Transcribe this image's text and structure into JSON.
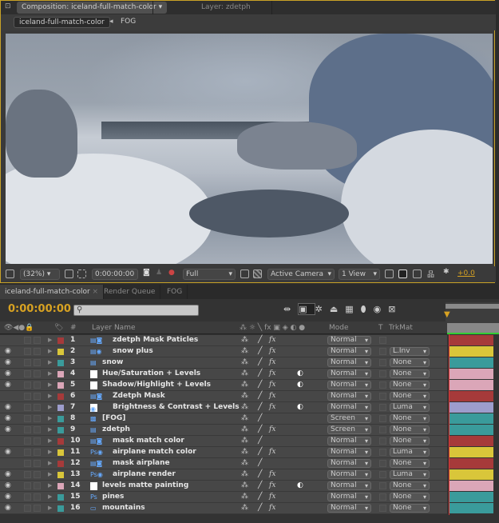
{
  "comp_panel": {
    "tab_label": "Composition: iceland-full-match-color",
    "layer_tab": "Layer: zdetph",
    "breadcrumb_active": "iceland-full-match-color",
    "breadcrumb_next": "FOG"
  },
  "viewer_toolbar": {
    "zoom": "(32%)",
    "timecode": "0:00:00:00",
    "resolution": "Full",
    "camera": "Active Camera",
    "views": "1 View",
    "exposure": "+0.0"
  },
  "timeline": {
    "tabs": [
      "iceland-full-match-color",
      "Render Queue",
      "FOG"
    ],
    "timecode": "0:00:00:00",
    "search_placeholder": "",
    "headers": {
      "num": "#",
      "layer_name": "Layer Name",
      "mode": "Mode",
      "t": "T",
      "trkmat": "TrkMat"
    }
  },
  "colors": {
    "red": "#a63a3a",
    "yellow": "#d9c63a",
    "teal": "#3a9b9b",
    "pink": "#dba6b8",
    "lavender": "#9d9dcc",
    "accent": "#d8a222"
  },
  "layers": [
    {
      "num": "1",
      "name": "zdetph Mask Paticles",
      "label": "red",
      "visible": false,
      "icon": "comp-mask",
      "fx": true,
      "adj": false,
      "mode": "Normal",
      "trkmat": ""
    },
    {
      "num": "2",
      "name": "snow plus",
      "label": "yellow",
      "visible": true,
      "icon": "comp-matte",
      "fx": true,
      "adj": false,
      "mode": "Normal",
      "trkmat": "L.Inv"
    },
    {
      "num": "3",
      "name": "snow",
      "label": "teal",
      "visible": true,
      "icon": "comp",
      "fx": true,
      "adj": false,
      "mode": "Normal",
      "trkmat": "None"
    },
    {
      "num": "4",
      "name": "Hue/Saturation + Levels",
      "label": "pink",
      "visible": true,
      "icon": "solid",
      "fx": true,
      "adj": true,
      "mode": "Normal",
      "trkmat": "None"
    },
    {
      "num": "5",
      "name": "Shadow/Highlight + Levels",
      "label": "pink",
      "visible": true,
      "icon": "solid",
      "fx": true,
      "adj": true,
      "mode": "Normal",
      "trkmat": "None"
    },
    {
      "num": "6",
      "name": "Zdetph Mask",
      "label": "red",
      "visible": false,
      "icon": "comp-mask",
      "fx": true,
      "adj": false,
      "mode": "Normal",
      "trkmat": "None"
    },
    {
      "num": "7",
      "name": "Brightness & Contrast + Levels",
      "label": "lavender",
      "visible": true,
      "icon": "solid-matte",
      "fx": true,
      "adj": true,
      "mode": "Normal",
      "trkmat": "Luma"
    },
    {
      "num": "8",
      "name": "[FOG]",
      "label": "teal",
      "visible": true,
      "icon": "precomp",
      "fx": false,
      "adj": false,
      "mode": "Screen",
      "trkmat": "None"
    },
    {
      "num": "9",
      "name": "zdetph",
      "label": "teal",
      "visible": true,
      "icon": "comp",
      "fx": true,
      "adj": false,
      "mode": "Screen",
      "trkmat": "None"
    },
    {
      "num": "10",
      "name": "mask match color",
      "label": "red",
      "visible": false,
      "icon": "comp-mask",
      "fx": false,
      "adj": false,
      "mode": "Normal",
      "trkmat": "None"
    },
    {
      "num": "11",
      "name": "airplane match color",
      "label": "yellow",
      "visible": true,
      "icon": "ps-matte",
      "fx": true,
      "adj": false,
      "mode": "Normal",
      "trkmat": "Luma"
    },
    {
      "num": "12",
      "name": "mask airplane",
      "label": "red",
      "visible": false,
      "icon": "comp-mask",
      "fx": false,
      "adj": false,
      "mode": "Normal",
      "trkmat": "None"
    },
    {
      "num": "13",
      "name": "airplane render",
      "label": "yellow",
      "visible": true,
      "icon": "ps-matte",
      "fx": true,
      "adj": false,
      "mode": "Normal",
      "trkmat": "Luma"
    },
    {
      "num": "14",
      "name": "levels matte painting",
      "label": "pink",
      "visible": true,
      "icon": "solid",
      "fx": true,
      "adj": true,
      "mode": "Normal",
      "trkmat": "None"
    },
    {
      "num": "15",
      "name": "pines",
      "label": "teal",
      "visible": true,
      "icon": "ps",
      "fx": true,
      "adj": false,
      "mode": "Normal",
      "trkmat": "None"
    },
    {
      "num": "16",
      "name": "mountains",
      "label": "teal",
      "visible": true,
      "icon": "image",
      "fx": true,
      "adj": false,
      "mode": "Normal",
      "trkmat": "None"
    }
  ]
}
